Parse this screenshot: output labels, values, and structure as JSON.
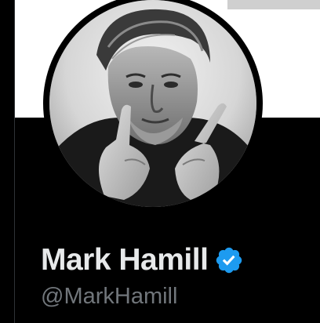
{
  "profile": {
    "display_name": "Mark Hamill",
    "handle": "@MarkHamill",
    "verified": true,
    "avatar_icon": "profile-photo",
    "verified_icon": "verified-badge-icon"
  },
  "colors": {
    "background": "#000000",
    "name_text": "#e7e9ea",
    "handle_text": "#71767b",
    "verified_badge": "#1d9bf0",
    "banner": "#ffffff"
  }
}
